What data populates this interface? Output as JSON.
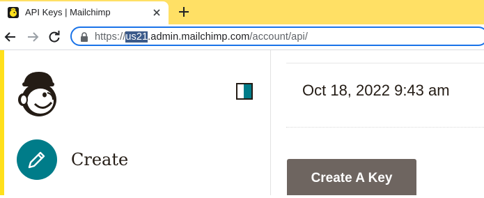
{
  "browser": {
    "tab_title": "API Keys | Mailchimp",
    "url": {
      "scheme": "https://",
      "selected": "us21",
      "host_rest": ".admin.mailchimp.com",
      "path": "/account/api/"
    }
  },
  "sidebar": {
    "items": [
      {
        "label": "Create",
        "icon": "pencil-icon"
      }
    ]
  },
  "main": {
    "created_date": "Oct 18, 2022 9:43 am",
    "create_key_label": "Create A Key"
  },
  "colors": {
    "tabstrip": "#ffe065",
    "brand_yellow": "#ffe01b",
    "teal": "#007c89",
    "button_gray": "#6e6560",
    "focus_blue": "#1a73e8"
  }
}
